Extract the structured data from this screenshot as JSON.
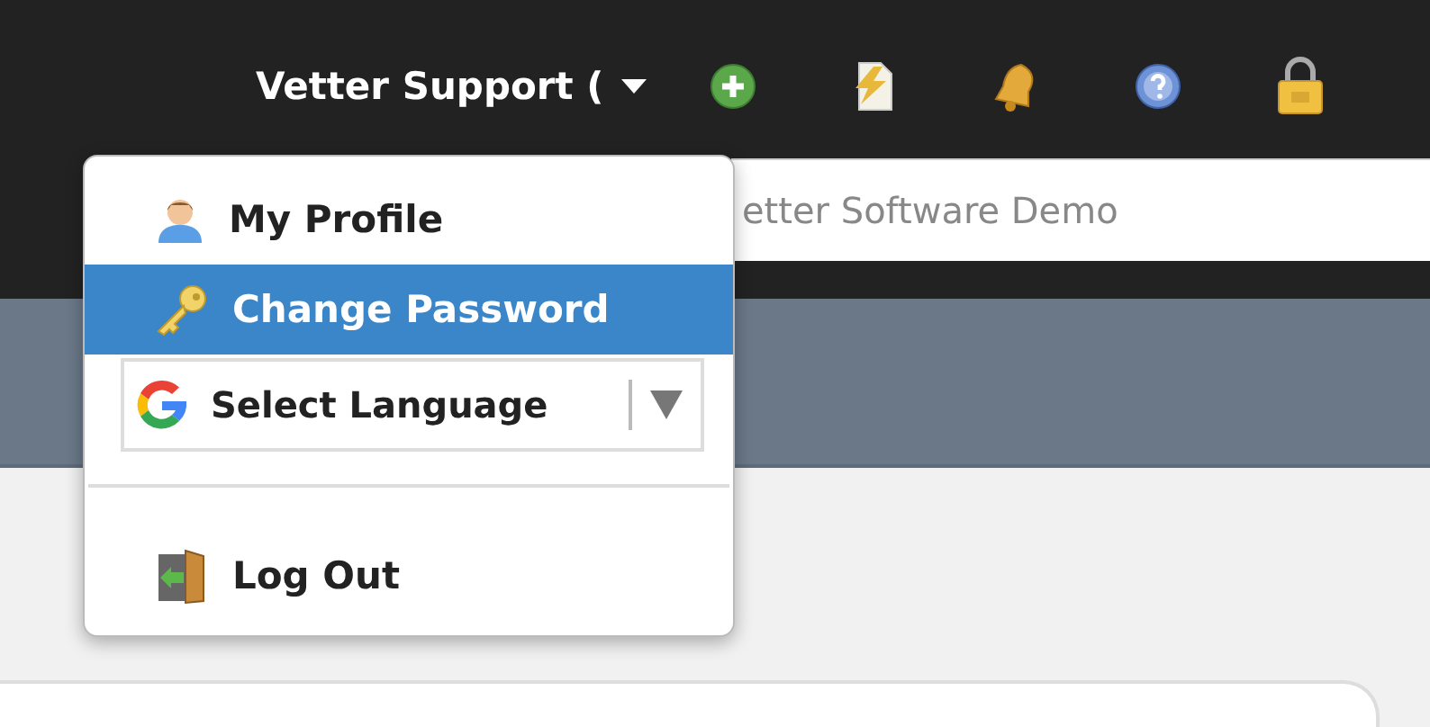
{
  "header": {
    "user_menu": {
      "label": "Vetter Support (",
      "expanded": true
    }
  },
  "search": {
    "value": "etter Software Demo"
  },
  "user_dropdown": {
    "items": [
      {
        "kind": "profile",
        "label": "My Profile",
        "selected": false
      },
      {
        "kind": "password",
        "label": "Change Password",
        "selected": true
      },
      {
        "kind": "language",
        "label": "Select Language"
      },
      {
        "kind": "divider"
      },
      {
        "kind": "logout",
        "label": "Log Out",
        "selected": false
      }
    ]
  }
}
